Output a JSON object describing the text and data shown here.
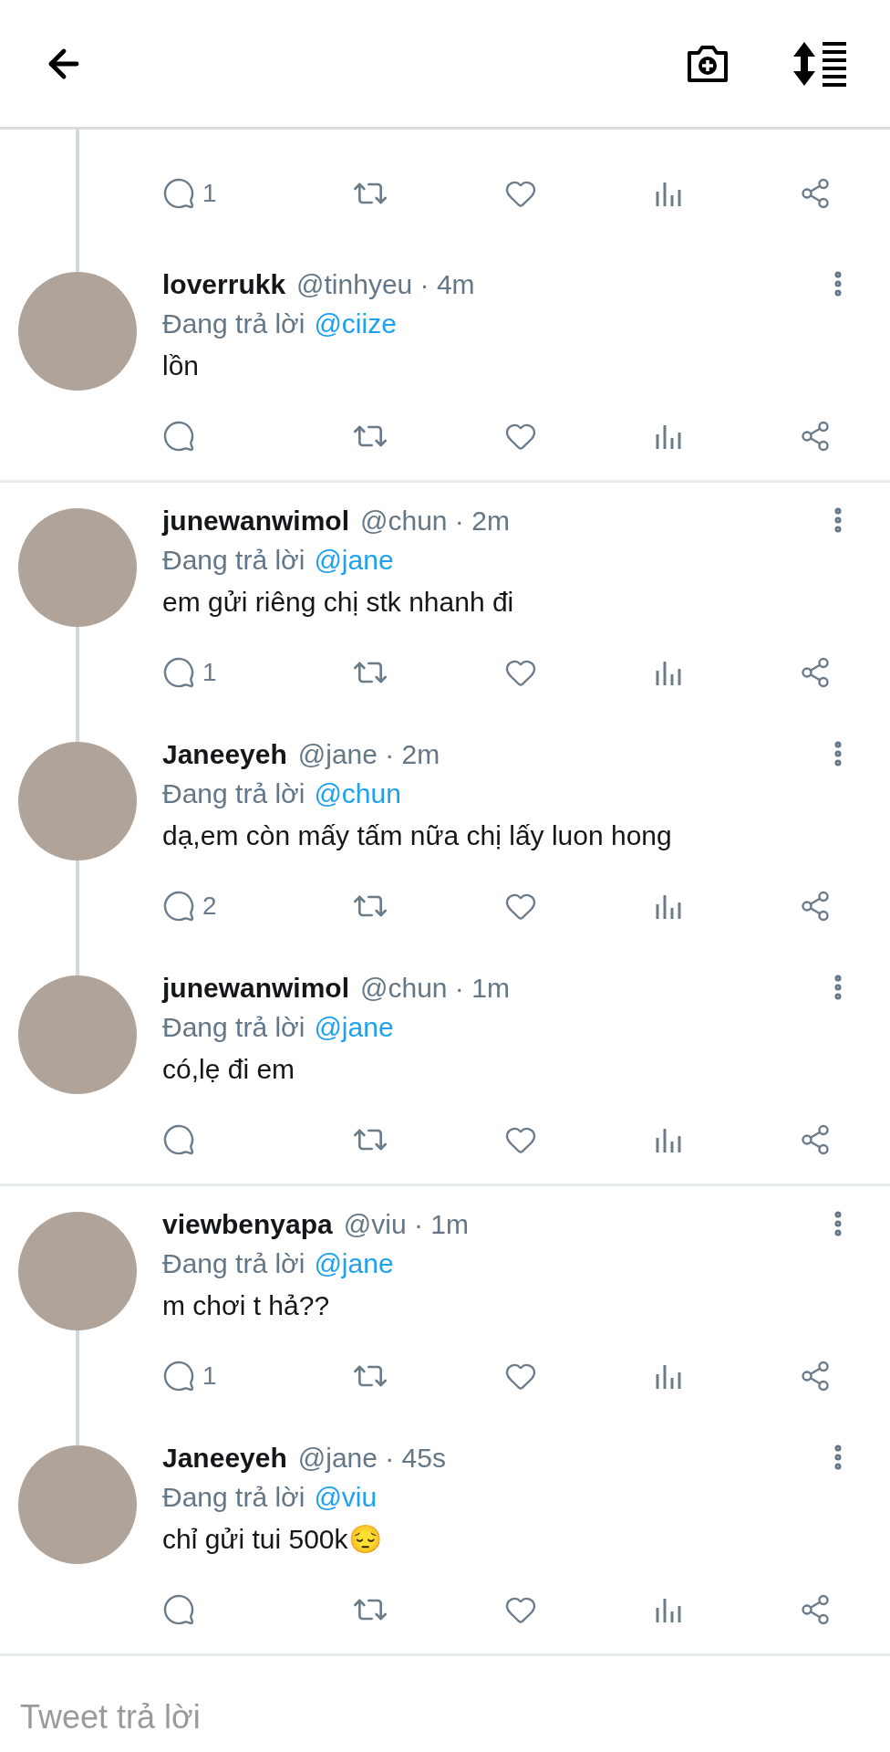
{
  "reply_field": {
    "placeholder": "Tweet trả lời"
  },
  "threads": [
    {
      "tweets": [
        {
          "kind": "partial",
          "reply_count": "1"
        },
        {
          "kind": "tweet",
          "name": "loverrukk",
          "handle": "@tinhyeu · 4m",
          "replying_label": "Đang trả lời",
          "replying_to": "@ciize",
          "text": "lồn"
        }
      ]
    },
    {
      "tweets": [
        {
          "kind": "tweet",
          "name": "junewanwimol",
          "handle": "@chun · 2m",
          "replying_label": "Đang trả lời",
          "replying_to": "@jane",
          "text": "em gửi riêng chị stk nhanh đi",
          "reply_count": "1"
        },
        {
          "kind": "tweet",
          "name": "Janeeyeh",
          "handle": "@jane · 2m",
          "replying_label": "Đang trả lời",
          "replying_to": "@chun",
          "text": "dạ,em còn mấy tấm nữa chị lấy luon hong",
          "reply_count": "2"
        },
        {
          "kind": "tweet",
          "name": "junewanwimol",
          "handle": "@chun · 1m",
          "replying_label": "Đang trả lời",
          "replying_to": "@jane",
          "text": "có,lẹ đi em"
        }
      ]
    },
    {
      "tweets": [
        {
          "kind": "tweet",
          "name": "viewbenyapa",
          "handle": "@viu · 1m",
          "replying_label": "Đang trả lời",
          "replying_to": "@jane",
          "text": "m chơi t hả??",
          "reply_count": "1"
        },
        {
          "kind": "tweet",
          "name": "Janeeyeh",
          "handle": "@jane · 45s",
          "replying_label": "Đang trả lời",
          "replying_to": "@viu",
          "text": "chỉ gửi tui 500k😔"
        }
      ]
    }
  ]
}
